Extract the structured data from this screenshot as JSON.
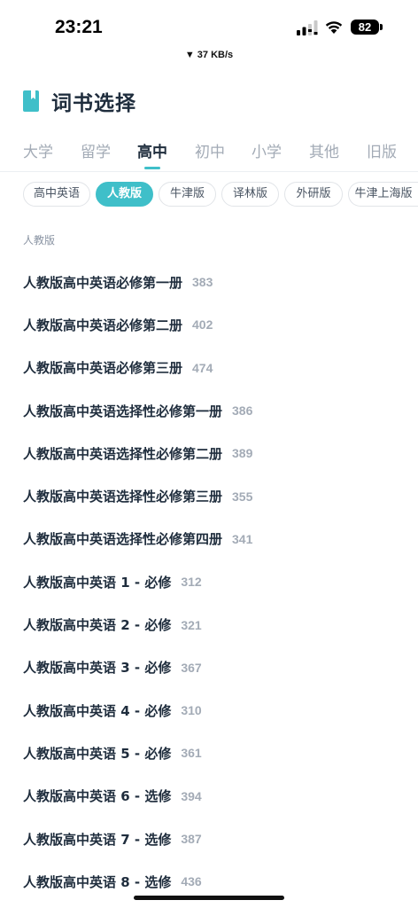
{
  "status_bar": {
    "time": "23:21",
    "battery": "82",
    "net_speed": "▼ 37 KB/s"
  },
  "header": {
    "title": "词书选择",
    "icon": "book-icon",
    "accent_color": "#3fbfc9"
  },
  "tabs": [
    {
      "label": "大学",
      "active": false
    },
    {
      "label": "留学",
      "active": false
    },
    {
      "label": "高中",
      "active": true
    },
    {
      "label": "初中",
      "active": false
    },
    {
      "label": "小学",
      "active": false
    },
    {
      "label": "其他",
      "active": false
    },
    {
      "label": "旧版",
      "active": false
    }
  ],
  "chips": [
    {
      "label": "高中英语",
      "active": false
    },
    {
      "label": "人教版",
      "active": true
    },
    {
      "label": "牛津版",
      "active": false
    },
    {
      "label": "译林版",
      "active": false
    },
    {
      "label": "外研版",
      "active": false
    },
    {
      "label": "牛津上海版",
      "active": false
    }
  ],
  "section": {
    "label": "人教版"
  },
  "books": [
    {
      "name": "人教版高中英语必修第一册",
      "count": "383"
    },
    {
      "name": "人教版高中英语必修第二册",
      "count": "402"
    },
    {
      "name": "人教版高中英语必修第三册",
      "count": "474"
    },
    {
      "name": "人教版高中英语选择性必修第一册",
      "count": "386"
    },
    {
      "name": "人教版高中英语选择性必修第二册",
      "count": "389"
    },
    {
      "name": "人教版高中英语选择性必修第三册",
      "count": "355"
    },
    {
      "name": "人教版高中英语选择性必修第四册",
      "count": "341"
    },
    {
      "name": "人教版高中英语 1 - 必修",
      "count": "312"
    },
    {
      "name": "人教版高中英语 2 - 必修",
      "count": "321"
    },
    {
      "name": "人教版高中英语 3 - 必修",
      "count": "367"
    },
    {
      "name": "人教版高中英语 4 - 必修",
      "count": "310"
    },
    {
      "name": "人教版高中英语 5 - 必修",
      "count": "361"
    },
    {
      "name": "人教版高中英语 6 - 选修",
      "count": "394"
    },
    {
      "name": "人教版高中英语 7 - 选修",
      "count": "387"
    },
    {
      "name": "人教版高中英语 8 - 选修",
      "count": "436"
    }
  ]
}
